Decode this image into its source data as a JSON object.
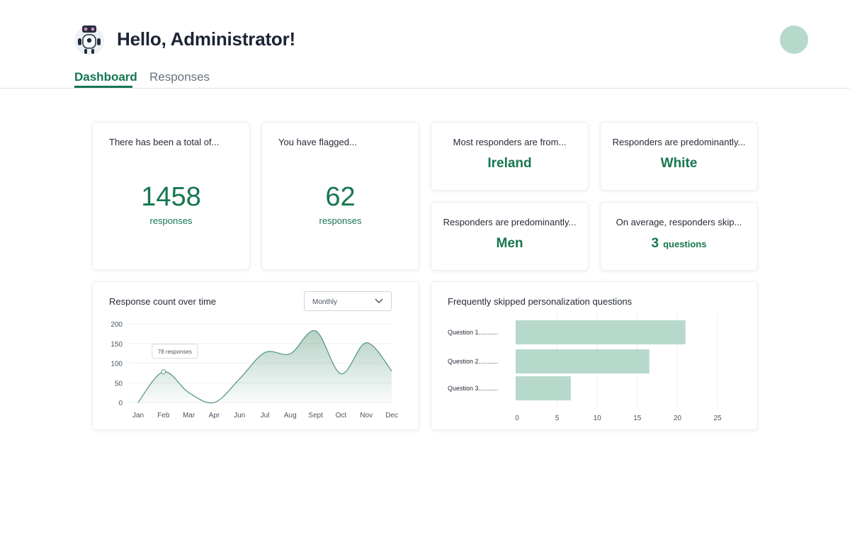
{
  "header": {
    "greeting": "Hello, Administrator!",
    "logo_icon": "robot-icon",
    "avatar_color": "#b6d9cb"
  },
  "tabs": [
    {
      "label": "Dashboard",
      "active": true
    },
    {
      "label": "Responses",
      "active": false
    }
  ],
  "stats": {
    "total": {
      "label": "There has been a total of...",
      "value": "1458",
      "unit": "responses"
    },
    "flagged": {
      "label": "You have flagged...",
      "value": "62",
      "unit": "responses"
    },
    "country": {
      "label": "Most responders are from...",
      "value": "Ireland"
    },
    "ethnicity": {
      "label": "Responders are predominantly...",
      "value": "White"
    },
    "gender": {
      "label": "Responders are predominantly...",
      "value": "Men"
    },
    "skips": {
      "label": "On average, responders skip...",
      "value": "3",
      "unit": "questions"
    }
  },
  "line_chart": {
    "title": "Response count over time",
    "select_value": "Monthly",
    "tooltip": "78 responses"
  },
  "bar_chart": {
    "title": "Frequently skipped personalization questions"
  },
  "colors": {
    "accent": "#17764f",
    "line": "#5b9a80",
    "bar": "#b6d9cb"
  },
  "chart_data": [
    {
      "type": "area",
      "title": "Response count over time",
      "categories": [
        "Jan",
        "Feb",
        "Mar",
        "Apr",
        "Jun",
        "Jul",
        "Aug",
        "Sept",
        "Oct",
        "Nov",
        "Dec"
      ],
      "values": [
        0,
        78,
        25,
        0,
        60,
        127,
        124,
        182,
        73,
        152,
        80
      ],
      "ylim": [
        0,
        200
      ],
      "yticks": [
        0,
        50,
        100,
        150,
        200
      ],
      "grid": true,
      "highlight": {
        "category": "Feb",
        "label": "78 responses"
      }
    },
    {
      "type": "bar",
      "orientation": "horizontal",
      "title": "Frequently skipped personalization questions",
      "categories": [
        "Question 1...........",
        "Question 2...........",
        "Question 3..........."
      ],
      "values": [
        21,
        16.5,
        6.7
      ],
      "xlim": [
        0,
        25
      ],
      "xticks": [
        0,
        5,
        10,
        15,
        20,
        25
      ],
      "grid": true
    }
  ]
}
